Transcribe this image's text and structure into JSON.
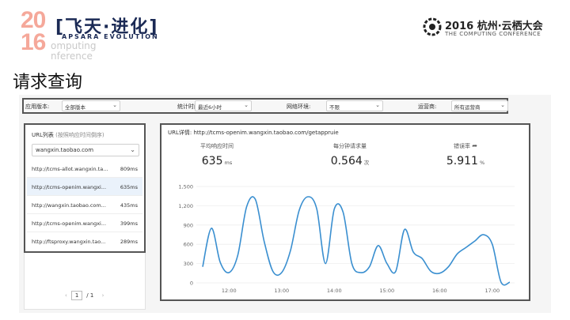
{
  "slide": {
    "logo_year_top": "20",
    "logo_year_bottom": "16",
    "logo_chinese": "[飞天·进化]",
    "logo_apsara": "APSARA EVOLUTION",
    "logo_computing_1": "omputing",
    "logo_computing_2": "nference",
    "conf_title": "2016 杭州·云栖大会",
    "conf_subtitle": "THE COMPUTING CONFERENCE",
    "title": "请求查询"
  },
  "filters": {
    "app_version_label": "应用版本:",
    "app_version_value": "全部版本",
    "stat_time_label": "统计时间:",
    "stat_time_value": "最近6小时",
    "network_label": "网络环境:",
    "network_value": "不限",
    "carrier_label": "运营商:",
    "carrier_value": "所有运营商"
  },
  "url_list": {
    "title": "URL列表",
    "subtitle": "(按照响应时间倒序)",
    "selected_domain": "wangxin.taobao.com",
    "rows": [
      {
        "url": "http://tcms-allot.wangxin.ta...",
        "ms": "809ms"
      },
      {
        "url": "http://tcms-openim.wangxi...",
        "ms": "635ms"
      },
      {
        "url": "http://wangxin.taobao.com...",
        "ms": "435ms"
      },
      {
        "url": "http://tcms-openim.wangxi...",
        "ms": "399ms"
      },
      {
        "url": "http://ftsproxy.wangxin.tao...",
        "ms": "289ms"
      }
    ],
    "pager": {
      "prev": "‹",
      "page": "1",
      "sep": "/",
      "total": "1",
      "next": "›"
    }
  },
  "detail": {
    "title": "URL详情: http://tcms-openim.wangxin.taobao.com/getappruie",
    "metrics": [
      {
        "label": "平均响应时间",
        "value": "635",
        "unit": "ms"
      },
      {
        "label": "每分钟请求量",
        "value": "0.564",
        "unit": "次"
      },
      {
        "label": "错误率",
        "value": "5.911",
        "unit": "%"
      }
    ]
  },
  "chart_data": {
    "type": "line",
    "color": "#3a8fd0",
    "ylim": [
      0,
      1500
    ],
    "y_ticks": [
      0,
      300,
      600,
      900,
      1200,
      1500
    ],
    "y_tick_labels": [
      "0",
      "300",
      "600",
      "900",
      "1,200",
      "1,500"
    ],
    "x_tick_labels": [
      "12:00",
      "13:00",
      "14:00",
      "15:00",
      "16:00",
      "17:00"
    ],
    "x": [
      "11:30",
      "11:40",
      "11:50",
      "12:00",
      "12:10",
      "12:20",
      "12:30",
      "12:40",
      "12:50",
      "13:00",
      "13:10",
      "13:20",
      "13:30",
      "13:40",
      "13:50",
      "14:00",
      "14:10",
      "14:20",
      "14:30",
      "14:40",
      "14:50",
      "15:00",
      "15:10",
      "15:20",
      "15:30",
      "15:40",
      "15:50",
      "16:00",
      "16:10",
      "16:20",
      "16:30",
      "16:40",
      "16:50",
      "17:00",
      "17:10",
      "17:20"
    ],
    "values": [
      250,
      850,
      320,
      160,
      430,
      1180,
      1300,
      650,
      180,
      160,
      500,
      1130,
      1340,
      1150,
      300,
      1150,
      1100,
      300,
      160,
      250,
      580,
      300,
      180,
      830,
      480,
      380,
      180,
      150,
      250,
      450,
      550,
      650,
      750,
      600,
      10,
      10
    ]
  }
}
